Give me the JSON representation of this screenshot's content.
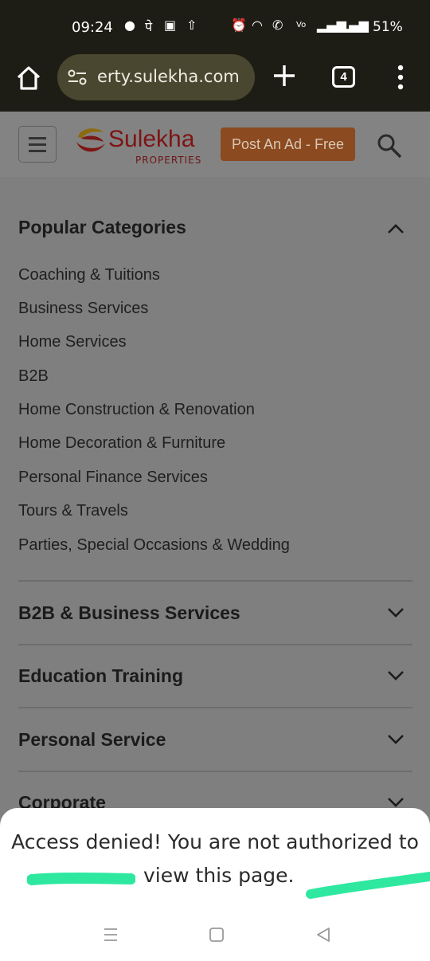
{
  "status_bar": {
    "time": "09:24",
    "icons": [
      "chat-icon",
      "pe-icon",
      "app-icon",
      "upload-icon",
      "alarm-icon",
      "wifi-icon",
      "call-icon",
      "volte-icon",
      "signal-icon",
      "signal-icon"
    ],
    "battery": "51%"
  },
  "browser": {
    "url": "erty.sulekha.com",
    "tab_count": "4"
  },
  "site": {
    "logo_text": "Sulekha",
    "logo_sub": "PROPERTIES",
    "post_ad_label": "Post An Ad - Free"
  },
  "popular": {
    "title": "Popular Categories",
    "items": [
      "Coaching & Tuitions",
      "Business Services",
      "Home Services",
      "B2B",
      "Home Construction & Renovation",
      "Home Decoration & Furniture",
      "Personal Finance Services",
      "Tours & Travels",
      "Parties, Special Occasions & Wedding"
    ]
  },
  "sections": [
    {
      "title": "B2B & Business Services"
    },
    {
      "title": "Education Training"
    },
    {
      "title": "Personal Service"
    },
    {
      "title": "Corporate"
    }
  ],
  "toast": {
    "line1": "Access denied! You are not authorized to",
    "line2": "view this page."
  },
  "colors": {
    "highlight": "#2ee8a0",
    "accent": "#e8731f",
    "brand": "#c0282a"
  }
}
